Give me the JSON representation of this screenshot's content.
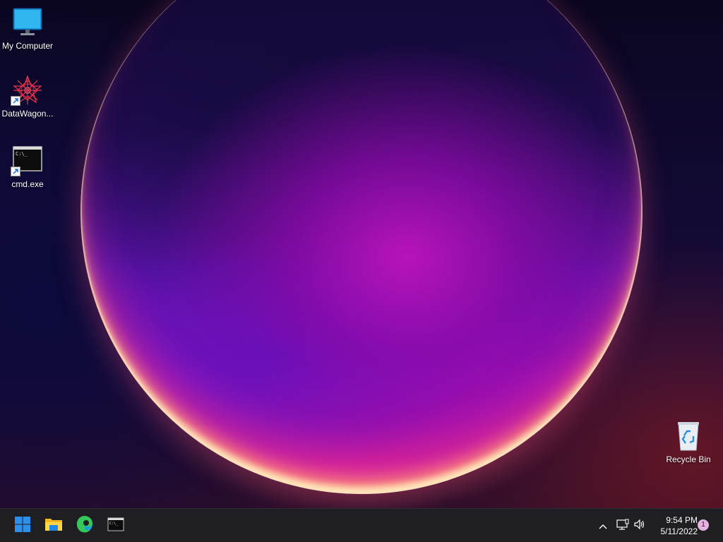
{
  "desktop": {
    "icons": [
      {
        "label": "My Computer",
        "icon": "monitor-icon"
      },
      {
        "label": "DataWagon...",
        "icon": "datawagon-icon"
      },
      {
        "label": "cmd.exe",
        "icon": "terminal-icon"
      },
      {
        "label": "Recycle Bin",
        "icon": "recycle-bin-icon"
      }
    ],
    "colors": {
      "orb_core": "#a011b5",
      "orb_rim": "#ffe6b8",
      "background": "#0a0620"
    }
  },
  "taskbar": {
    "apps": [
      {
        "icon": "windows-start-icon"
      },
      {
        "icon": "file-explorer-icon"
      },
      {
        "icon": "edge-browser-icon"
      },
      {
        "icon": "terminal-icon"
      }
    ],
    "tray": {
      "icons": [
        "chevron-up-icon",
        "network-icon",
        "volume-icon"
      ],
      "time": "9:54 PM",
      "date": "5/11/2022",
      "notification_count": "1"
    },
    "colors": {
      "background": "#1f1f23",
      "start_blue": "#2e8fe8",
      "badge": "#e6b3e0"
    }
  }
}
